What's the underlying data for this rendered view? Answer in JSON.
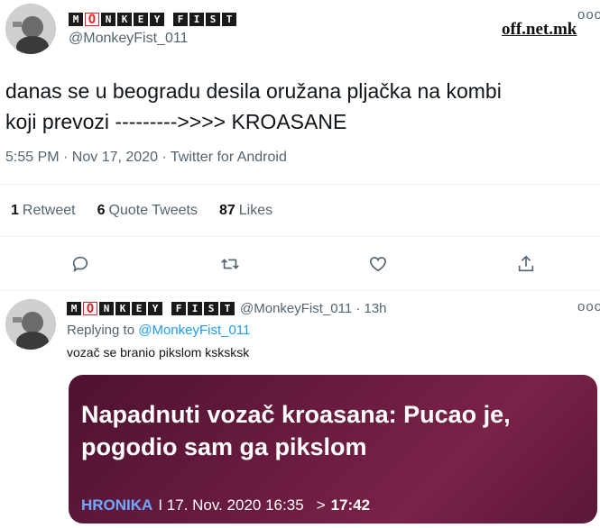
{
  "main_tweet": {
    "brand_letters": [
      "M",
      "O",
      "N",
      "K",
      "E",
      "Y",
      "F",
      "I",
      "S",
      "T"
    ],
    "handle": "@MonkeyFist_011",
    "watermark": "off.net.mk",
    "more": "ooo",
    "text_line1": "danas se u beogradu desila oružana pljačka na kombi",
    "text_line2": "koji prevozi --------->>>> KROASANE",
    "meta": "5:55 PM · Nov 17, 2020 · Twitter for Android",
    "stats": {
      "retweets_count": "1",
      "retweets_label": "Retweet",
      "quotes_count": "6",
      "quotes_label": "Quote Tweets",
      "likes_count": "87",
      "likes_label": "Likes"
    },
    "actions": [
      "reply-icon",
      "retweet-icon",
      "like-icon",
      "share-icon"
    ]
  },
  "reply_tweet": {
    "handle_time": "@MonkeyFist_011 · 13h",
    "more": "ooo",
    "replying_prefix": "Replying to",
    "replying_handle": "@MonkeyFist_011",
    "text": "vozač se branio pikslom ksksksk",
    "card": {
      "title": "Napadnuti vozač kroasana: Pucao je, pogodio sam ga pikslom",
      "category": "HRONIKA",
      "date": "I 17. Nov. 2020 16:35",
      "arrow": ">",
      "time": "17:42"
    }
  },
  "colors": {
    "text": "#0f1419",
    "secondary": "#536471",
    "link": "#1d9bf0",
    "card_bg": "#6a1c40",
    "card_category": "#6fa9ff",
    "brand_red": "#e0242b"
  }
}
